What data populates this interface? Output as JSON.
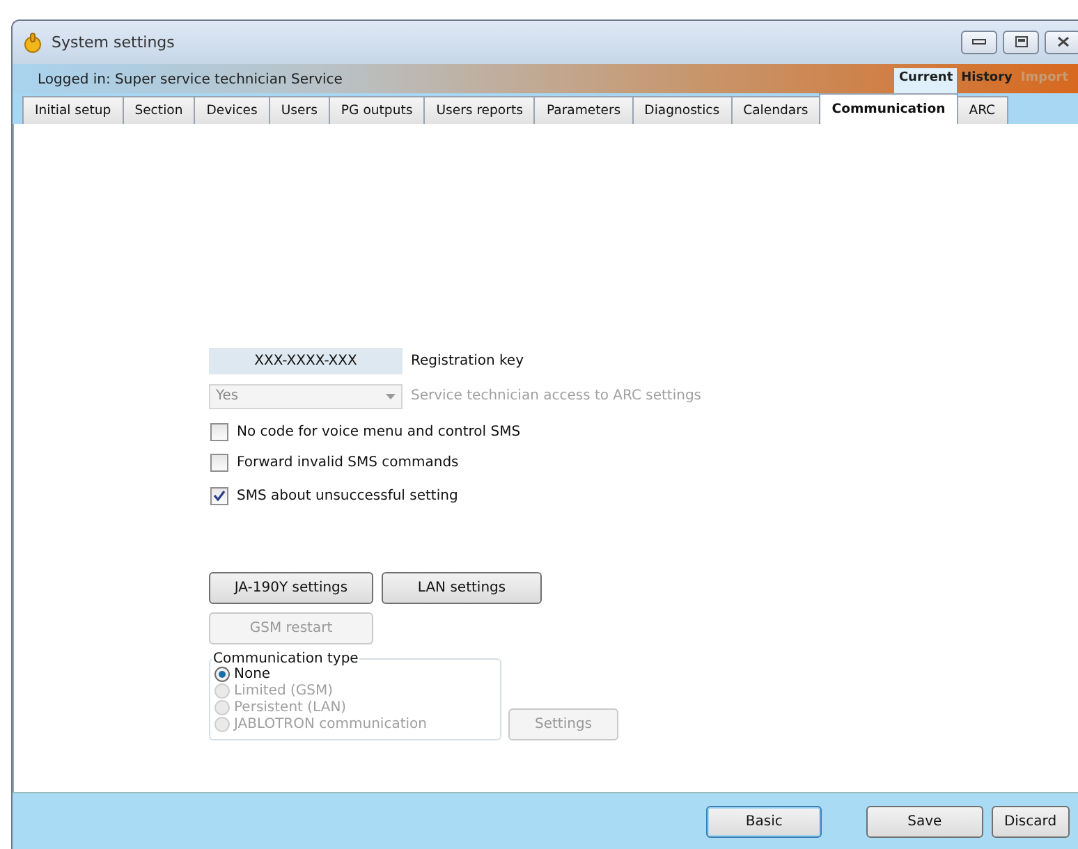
{
  "window": {
    "title": "System settings"
  },
  "login_bar": {
    "text": "Logged in: Super service technician Service",
    "modes": [
      {
        "label": "Current",
        "selected": true,
        "disabled": false
      },
      {
        "label": "History",
        "selected": false,
        "disabled": false
      },
      {
        "label": "Import",
        "selected": false,
        "disabled": true
      }
    ]
  },
  "tabs": [
    {
      "label": "Initial setup",
      "selected": false
    },
    {
      "label": "Section",
      "selected": false
    },
    {
      "label": "Devices",
      "selected": false
    },
    {
      "label": "Users",
      "selected": false
    },
    {
      "label": "PG outputs",
      "selected": false
    },
    {
      "label": "Users reports",
      "selected": false
    },
    {
      "label": "Parameters",
      "selected": false
    },
    {
      "label": "Diagnostics",
      "selected": false
    },
    {
      "label": "Calendars",
      "selected": false
    },
    {
      "label": "Communication",
      "selected": true
    },
    {
      "label": "ARC",
      "selected": false
    }
  ],
  "registration_key": {
    "value": "XXX-XXXX-XXX",
    "label": "Registration key"
  },
  "arc_access": {
    "value": "Yes",
    "label": "Service technician access to ARC settings",
    "disabled": true
  },
  "checkboxes": [
    {
      "label": "No code for voice menu and control SMS",
      "checked": false
    },
    {
      "label": "Forward invalid SMS commands",
      "checked": false
    },
    {
      "label": "SMS about unsuccessful setting",
      "checked": true
    }
  ],
  "buttons": [
    {
      "label": "JA-190Y settings",
      "disabled": false
    },
    {
      "label": "LAN settings",
      "disabled": false
    }
  ],
  "gsm_restart": {
    "label": "GSM restart",
    "disabled": true
  },
  "communication_type": {
    "title": "Communication type",
    "options": [
      {
        "label": "None",
        "selected": true,
        "disabled": false
      },
      {
        "label": "Limited (GSM)",
        "selected": false,
        "disabled": true
      },
      {
        "label": "Persistent (LAN)",
        "selected": false,
        "disabled": true
      },
      {
        "label": "JABLOTRON communication",
        "selected": false,
        "disabled": true
      }
    ],
    "settings": {
      "label": "Settings",
      "disabled": true
    }
  },
  "footer": [
    {
      "label": "Basic",
      "focused": true
    },
    {
      "label": "Save",
      "focused": false
    },
    {
      "label": "Discard",
      "focused": false
    }
  ]
}
